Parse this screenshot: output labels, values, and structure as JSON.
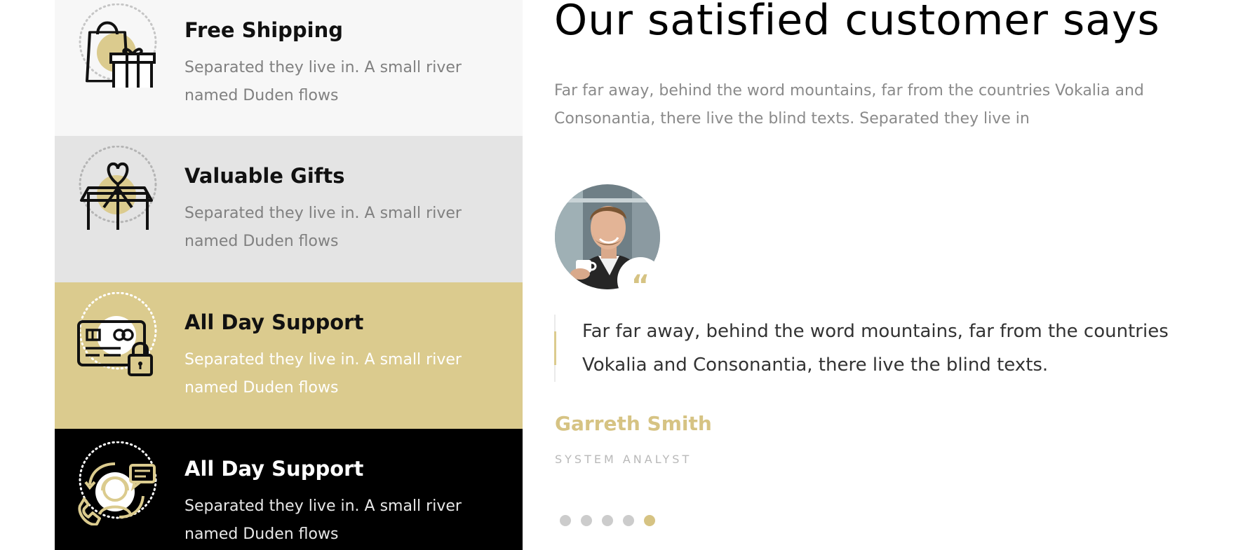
{
  "features": [
    {
      "title": "Free Shipping",
      "description": "Separated they live in. A small river named Duden flows",
      "icon": "shopping-bag-gift-icon"
    },
    {
      "title": "Valuable Gifts",
      "description": "Separated they live in. A small river named Duden flows",
      "icon": "gift-box-heart-icon"
    },
    {
      "title": "All Day Support",
      "description": "Separated they live in. A small river named Duden flows",
      "icon": "card-lock-icon"
    },
    {
      "title": "All Day Support",
      "description": "Separated they live in. A small river named Duden flows",
      "icon": "headset-support-icon"
    }
  ],
  "testimonial": {
    "heading": "Our satisfied customer says",
    "intro": "Far far away, behind the word mountains, far from the countries Vokalia and Consonantia, there live the blind texts. Separated they live in",
    "quote": "Far far away, behind the word mountains, far from the countries Vokalia and Consonantia, there live the blind texts.",
    "name": "Garreth Smith",
    "role": "SYSTEM ANALYST",
    "quote_icon": "quote-icon",
    "carousel": {
      "count": 5,
      "active_index": 5
    }
  },
  "colors": {
    "accent": "#dbcb8e",
    "accent_text": "#d6c383",
    "muted_text": "#808080",
    "panel_light": "#f7f7f7",
    "panel_gray": "#e4e4e4",
    "panel_dark": "#000000"
  }
}
